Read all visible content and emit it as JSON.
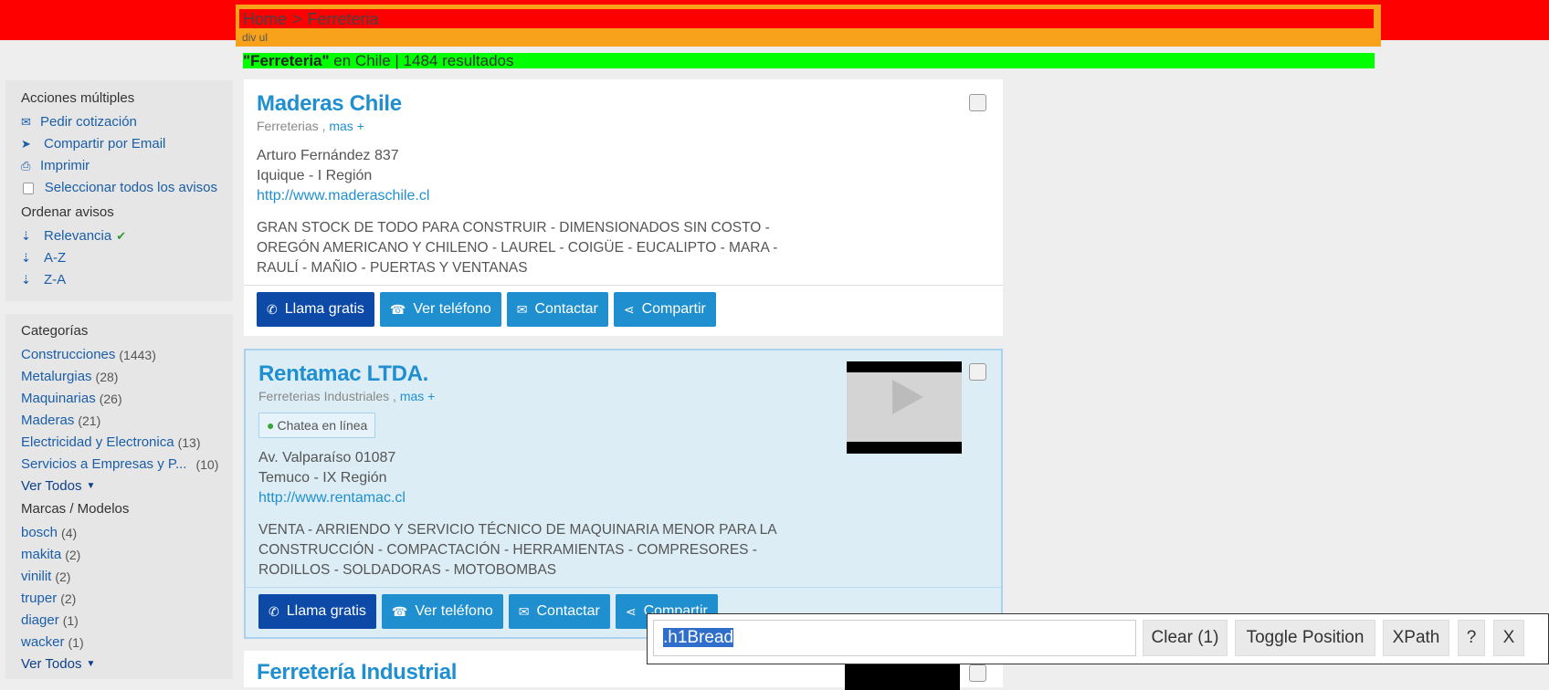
{
  "breadcrumb": {
    "home": "Home",
    "sep": ">",
    "current": "Ferreteria",
    "tag": "div ul"
  },
  "results": {
    "query": "\"Ferreteria\"",
    "rest": "en Chile | 1484 resultados"
  },
  "actions": {
    "title": "Acciones múltiples",
    "items": [
      {
        "label": "Pedir cotización",
        "icon": "envelope-icon"
      },
      {
        "label": "Compartir por Email",
        "icon": "paper-plane-icon"
      },
      {
        "label": "Imprimir",
        "icon": "print-icon"
      },
      {
        "label": "Seleccionar todos los avisos",
        "icon": "checkbox-icon"
      }
    ]
  },
  "sort": {
    "title": "Ordenar avisos",
    "items": [
      {
        "label": "Relevancia",
        "active": true
      },
      {
        "label": "A-Z"
      },
      {
        "label": "Z-A"
      }
    ]
  },
  "categories": {
    "title": "Categorías",
    "items": [
      {
        "label": "Construcciones",
        "count": "(1443)"
      },
      {
        "label": "Metalurgias",
        "count": "(28)"
      },
      {
        "label": "Maquinarias",
        "count": "(26)"
      },
      {
        "label": "Maderas",
        "count": "(21)"
      },
      {
        "label": "Electricidad y Electronica",
        "count": "(13)"
      },
      {
        "label": "Servicios a Empresas y P...",
        "count": "(10)"
      }
    ],
    "see_all": "Ver Todos"
  },
  "brands": {
    "title": "Marcas / Modelos",
    "items": [
      {
        "label": "bosch",
        "count": "(4)"
      },
      {
        "label": "makita",
        "count": "(2)"
      },
      {
        "label": "vinilit",
        "count": "(2)"
      },
      {
        "label": "truper",
        "count": "(2)"
      },
      {
        "label": "diager",
        "count": "(1)"
      },
      {
        "label": "wacker",
        "count": "(1)"
      }
    ],
    "see_all": "Ver Todos"
  },
  "listings": [
    {
      "title": "Maderas Chile",
      "category": "Ferreterias ,",
      "more": "mas +",
      "address": "Arturo Fernández 837",
      "city": "Iquique - I Región",
      "url": "http://www.maderaschile.cl",
      "desc": "GRAN STOCK DE TODO PARA CONSTRUIR - DIMENSIONADOS SIN COSTO - OREGÓN AMERICANO Y CHILENO - LAUREL - COIGÜE - EUCALIPTO - MARA - RAULÍ - MAÑIO - PUERTAS Y VENTANAS"
    },
    {
      "title": "Rentamac LTDA.",
      "category": "Ferreterias Industriales ,",
      "more": "mas +",
      "chat": "Chatea en línea",
      "address": "Av. Valparaíso 01087",
      "city": "Temuco - IX Región",
      "url": "http://www.rentamac.cl",
      "desc": "VENTA - ARRIENDO Y SERVICIO TÉCNICO DE MAQUINARIA MENOR PARA LA CONSTRUCCIÓN - COMPACTACIÓN - HERRAMIENTAS - COMPRESORES - RODILLOS - SOLDADORAS - MOTOBOMBAS"
    },
    {
      "title": "Ferretería Industrial"
    }
  ],
  "buttons": {
    "call": "Llama gratis",
    "phone": "Ver teléfono",
    "contact": "Contactar",
    "share": "Compartir"
  },
  "tool": {
    "input": ".h1Bread",
    "clear": "Clear (1)",
    "toggle": "Toggle Position",
    "xpath": "XPath",
    "help": "?",
    "close": "X"
  }
}
